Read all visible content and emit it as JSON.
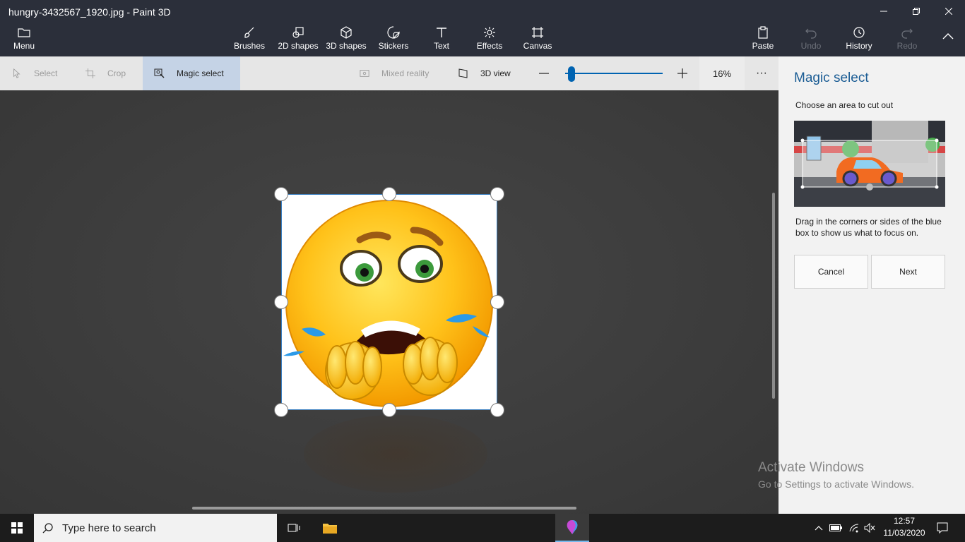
{
  "window": {
    "title": "hungry-3432567_1920.jpg - Paint 3D",
    "minimize_icon": "minimize-icon",
    "restore_icon": "restore-icon",
    "close_icon": "close-icon"
  },
  "toolbar": {
    "menu_label": "Menu",
    "tools": [
      {
        "label": "Brushes",
        "icon": "brush-icon"
      },
      {
        "label": "2D shapes",
        "icon": "2d-shapes-icon"
      },
      {
        "label": "3D shapes",
        "icon": "3d-shapes-icon"
      },
      {
        "label": "Stickers",
        "icon": "stickers-icon"
      },
      {
        "label": "Text",
        "icon": "text-icon"
      },
      {
        "label": "Effects",
        "icon": "effects-icon"
      },
      {
        "label": "Canvas",
        "icon": "canvas-icon"
      }
    ],
    "right": [
      {
        "label": "Paste",
        "icon": "paste-icon"
      },
      {
        "label": "Undo",
        "icon": "undo-icon"
      },
      {
        "label": "History",
        "icon": "history-icon"
      },
      {
        "label": "Redo",
        "icon": "redo-icon"
      }
    ]
  },
  "subbar": {
    "select_label": "Select",
    "crop_label": "Crop",
    "magic_select_label": "Magic select",
    "mixed_reality_label": "Mixed reality",
    "view_3d_label": "3D view",
    "zoom_percent": "16%",
    "zoom_level": 0.03,
    "more_label": "···"
  },
  "panel": {
    "title": "Magic select",
    "subtitle": "Choose an area to cut out",
    "description": "Drag in the corners or sides of the blue box to show us what to focus on.",
    "cancel_label": "Cancel",
    "next_label": "Next"
  },
  "watermark": {
    "line1": "Activate Windows",
    "line2": "Go to Settings to activate Windows."
  },
  "taskbar": {
    "search_placeholder": "Type here to search",
    "time": "12:57",
    "date": "11/03/2020"
  },
  "colors": {
    "accent": "#0063b1",
    "toolbar_bg": "#2b2f3a",
    "panel_title": "#1a5c94",
    "selection": "#c5d3e6"
  }
}
